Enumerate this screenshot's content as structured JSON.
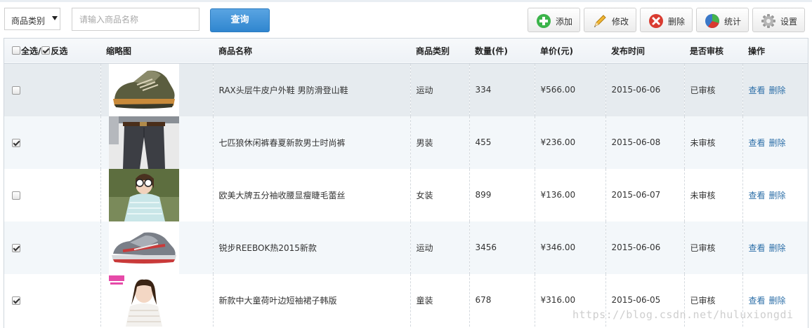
{
  "toolbar": {
    "category_select": "商品类别",
    "search_placeholder": "请输入商品名称",
    "query_label": "查询",
    "add_label": "添加",
    "edit_label": "修改",
    "delete_label": "删除",
    "stats_label": "统计",
    "settings_label": "设置"
  },
  "table": {
    "headers": {
      "select_all": "全选/",
      "invert": "反选",
      "thumb": "缩略图",
      "name": "商品名称",
      "category": "商品类别",
      "qty": "数量(件)",
      "price": "单价(元)",
      "date": "发布时间",
      "reviewed": "是否审核",
      "action": "操作"
    },
    "header_checks": {
      "select_all_checked": false,
      "invert_checked": true
    },
    "view_label": "查看",
    "delete_label": "删除",
    "rows": [
      {
        "checked": false,
        "thumb_icon": "hiking-shoe-image",
        "name": "RAX头层牛皮户外鞋 男防滑登山鞋",
        "category": "运动",
        "qty": "334",
        "price": "¥566.00",
        "date": "2015-06-06",
        "reviewed": "已审核"
      },
      {
        "checked": true,
        "thumb_icon": "men-trousers-image",
        "name": "七匹狼休闲裤春夏新款男士时尚裤",
        "category": "男装",
        "qty": "455",
        "price": "¥236.00",
        "date": "2015-06-08",
        "reviewed": "未审核"
      },
      {
        "checked": false,
        "thumb_icon": "lace-top-model-image",
        "name": "欧美大牌五分袖收腰显瘦睫毛蕾丝",
        "category": "女装",
        "qty": "899",
        "price": "¥136.00",
        "date": "2015-06-07",
        "reviewed": "未审核"
      },
      {
        "checked": true,
        "thumb_icon": "sneaker-image",
        "name": "锐步REEBOK热2015新款",
        "category": "运动",
        "qty": "3456",
        "price": "¥346.00",
        "date": "2015-06-06",
        "reviewed": "已审核"
      },
      {
        "checked": true,
        "thumb_icon": "girl-dress-image",
        "name": "新款中大童荷叶边短袖裙子韩版",
        "category": "童装",
        "qty": "678",
        "price": "¥316.00",
        "date": "2015-06-05",
        "reviewed": "已审核"
      }
    ]
  },
  "watermark": "https://blog.csdn.net/huluxiongdi",
  "colors": {
    "accent": "#3b8ed4",
    "link": "#2d6fa8",
    "alt_row": "#f3f7fa",
    "hover_row": "#e6ebef"
  }
}
